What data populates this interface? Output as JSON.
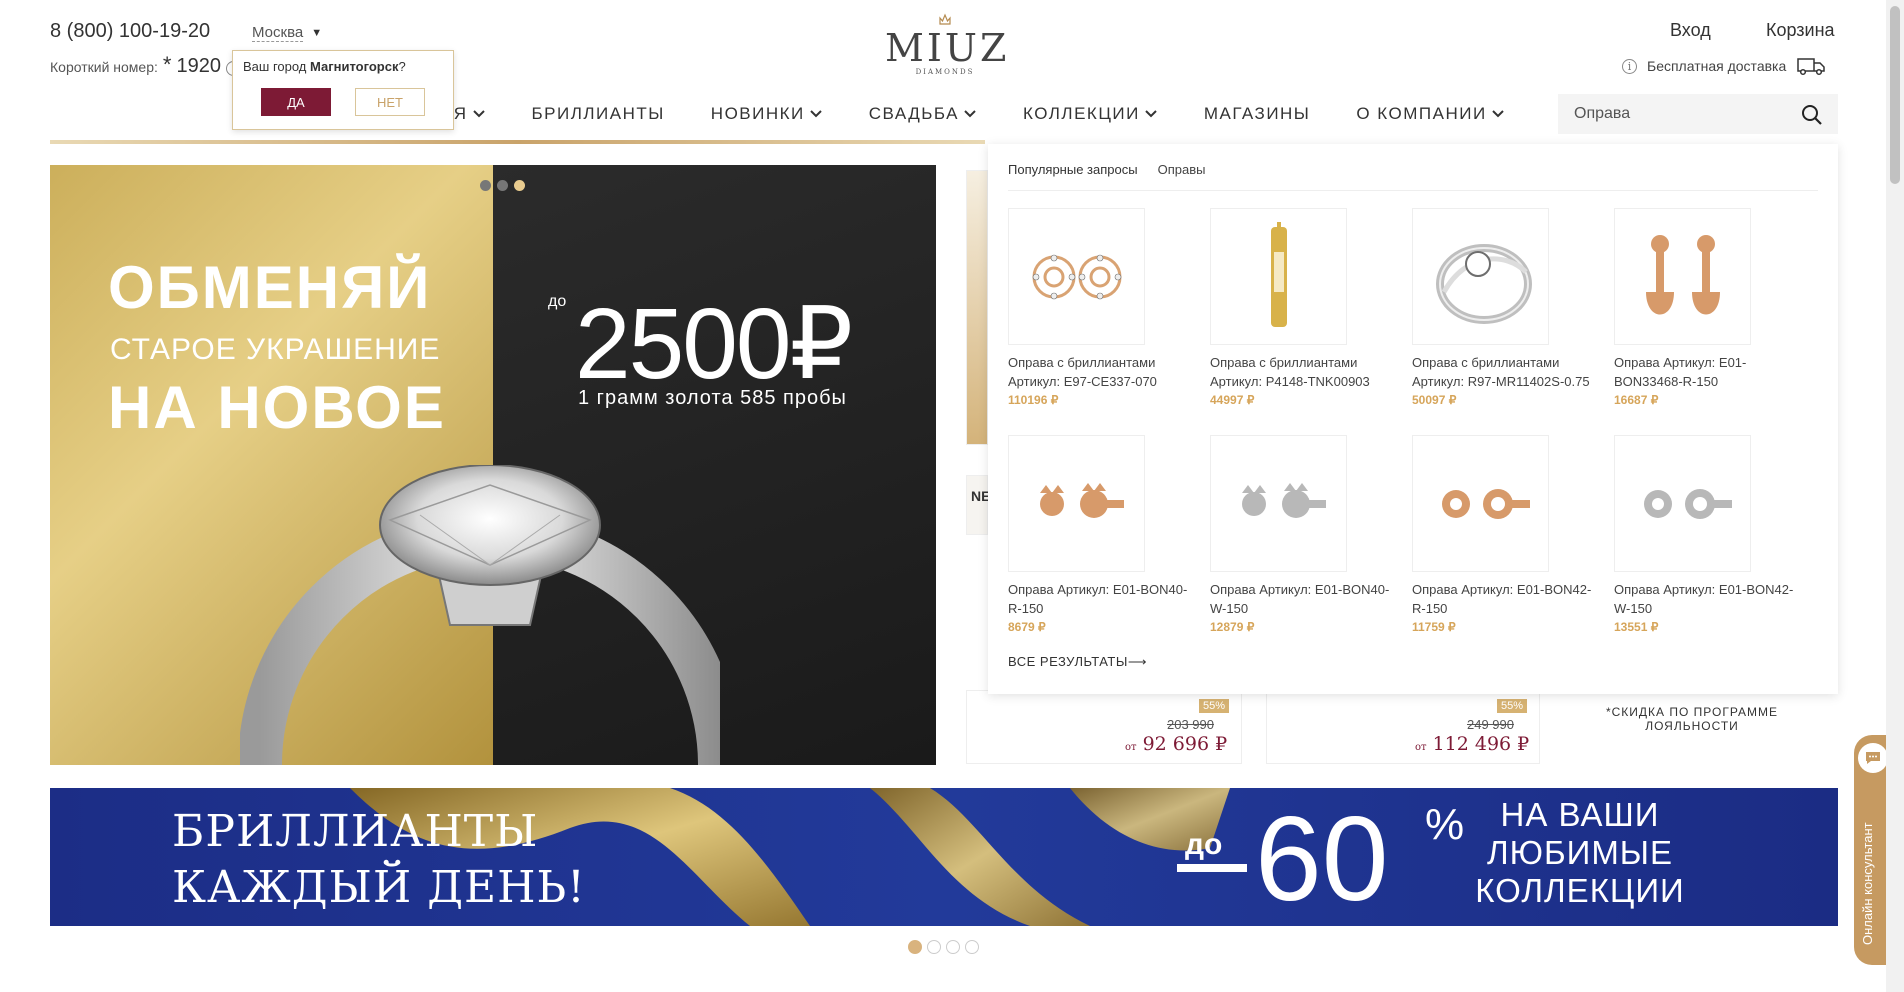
{
  "header": {
    "phone": "8 (800) 100-19-20",
    "short_label": "Короткий номер:",
    "short_star": "*",
    "short_number": "1920",
    "city": "Москва",
    "login": "Вход",
    "cart": "Корзина",
    "delivery": "Бесплатная доставка"
  },
  "city_popup": {
    "question_prefix": "Ваш город ",
    "city": "Магнитогорск",
    "question_suffix": "?",
    "yes": "ДА",
    "no": "НЕТ"
  },
  "logo": {
    "word": "MIUZ",
    "sub": "DIAMONDS"
  },
  "nav": {
    "items": [
      {
        "label": "ЯЯ",
        "dropdown": true
      },
      {
        "label": "БРИЛЛИАНТЫ",
        "dropdown": false
      },
      {
        "label": "НОВИНКИ",
        "dropdown": true
      },
      {
        "label": "СВАДЬБА",
        "dropdown": true
      },
      {
        "label": "КОЛЛЕКЦИИ",
        "dropdown": true
      },
      {
        "label": "МАГАЗИНЫ",
        "dropdown": false
      },
      {
        "label": "О КОМПАНИИ",
        "dropdown": true
      }
    ],
    "first_visible": "ИЯ"
  },
  "search": {
    "value": "Оправа"
  },
  "hero": {
    "line1": "ОБМЕНЯЙ",
    "line2": "СТАРОЕ УКРАШЕНИЕ",
    "line3": "НА НОВОЕ",
    "upto": "до",
    "amount": "2500₽",
    "note": "1 грамм золота 585 пробы"
  },
  "dropdown": {
    "popular_label": "Популярные запросы",
    "popular_tag": "Оправы",
    "all_results": "ВСЕ РЕЗУЛЬТАТЫ⟶",
    "products": [
      {
        "title": "Оправа с бриллиантами Артикул: E97-CE337-070",
        "price": "110196 ₽",
        "kind": "stud-halo",
        "metal": "#d9a373"
      },
      {
        "title": "Оправа с бриллиантами Артикул: P4148-TNK00903",
        "price": "44997 ₽",
        "kind": "pendant",
        "metal": "#d8b24a"
      },
      {
        "title": "Оправа с бриллиантами Артикул: R97-MR11402S-0.75",
        "price": "50097 ₽",
        "kind": "ring",
        "metal": "#bfbfbf"
      },
      {
        "title": "Оправа Артикул: E01-BON33468-R-150",
        "price": "16687 ₽",
        "kind": "hoop",
        "metal": "#d79a6a"
      },
      {
        "title": "Оправа Артикул: E01-BON40-R-150",
        "price": "8679 ₽",
        "kind": "stud",
        "metal": "#d79a6a"
      },
      {
        "title": "Оправа Артикул: E01-BON40-W-150",
        "price": "12879 ₽",
        "kind": "stud",
        "metal": "#b8b8b8"
      },
      {
        "title": "Оправа Артикул: E01-BON42-R-150",
        "price": "11759 ₽",
        "kind": "stud-round",
        "metal": "#d79a6a"
      },
      {
        "title": "Оправа Артикул: E01-BON42-W-150",
        "price": "13551 ₽",
        "kind": "stud-round",
        "metal": "#b8b8b8"
      }
    ]
  },
  "side_products": [
    {
      "discount": "55%",
      "old": "203 990",
      "from": "от",
      "price": "92 696 ₽"
    },
    {
      "discount": "55%",
      "old": "249 990",
      "from": "от",
      "price": "112 496 ₽"
    }
  ],
  "side_label": "NE",
  "loyalty": "*СКИДКА ПО ПРОГРАММЕ ЛОЯЛЬНОСТИ",
  "banner": {
    "left_line1": "БРИЛЛИАНТЫ",
    "left_line2": "КАЖДЫЙ ДЕНЬ!",
    "upto": "до",
    "value": "60",
    "percent": "%",
    "right_line1": "НА ВАШИ",
    "right_line2": "ЛЮБИМЫЕ",
    "right_line3": "КОЛЛЕКЦИИ"
  },
  "consultant": "Онлайн консультант",
  "colors": {
    "accent": "#7d1a35",
    "gold": "#c9a36a",
    "banner_blue": "#1f3190"
  }
}
